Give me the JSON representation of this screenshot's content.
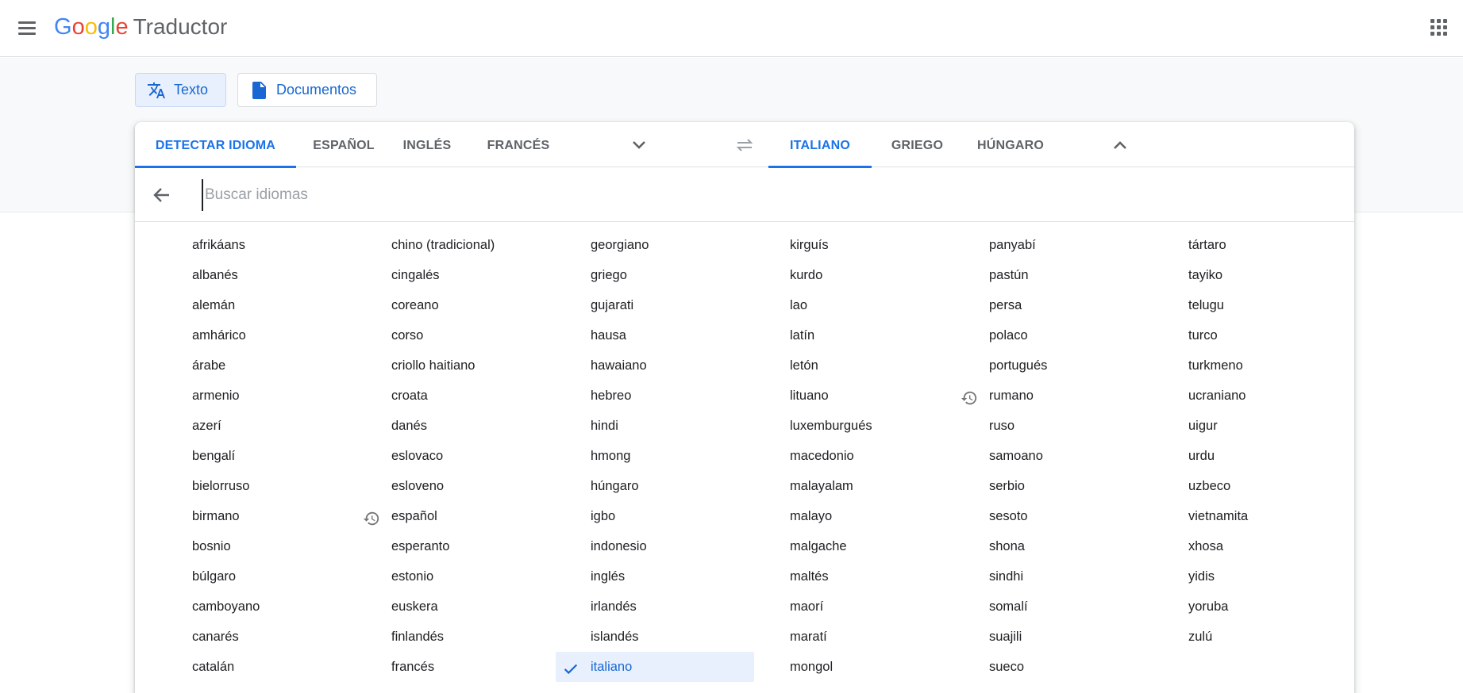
{
  "app": {
    "title": "Traductor",
    "logo_letters": [
      {
        "ch": "G",
        "color": "#4285f4"
      },
      {
        "ch": "o",
        "color": "#ea4335"
      },
      {
        "ch": "o",
        "color": "#fbbc05"
      },
      {
        "ch": "g",
        "color": "#4285f4"
      },
      {
        "ch": "l",
        "color": "#34a853"
      },
      {
        "ch": "e",
        "color": "#ea4335"
      }
    ]
  },
  "modes": {
    "text_label": "Texto",
    "docs_label": "Documentos"
  },
  "source_tabs": {
    "detect": "DETECTAR IDIOMA",
    "t1": "ESPAÑOL",
    "t2": "INGLÉS",
    "t3": "FRANCÉS"
  },
  "target_tabs": {
    "t1": "ITALIANO",
    "t2": "GRIEGO",
    "t3": "HÚNGARO"
  },
  "search": {
    "placeholder": "Buscar idiomas"
  },
  "languages": [
    [
      "afrikáans",
      "albanés",
      "alemán",
      "amhárico",
      "árabe",
      "armenio",
      "azerí",
      "bengalí",
      "bielorruso",
      "birmano",
      "bosnio",
      "búlgaro",
      "camboyano",
      "canarés",
      "catalán"
    ],
    [
      "chino (tradicional)",
      "cingalés",
      "coreano",
      "corso",
      "criollo haitiano",
      "croata",
      "danés",
      "eslovaco",
      "esloveno",
      "español",
      "esperanto",
      "estonio",
      "euskera",
      "finlandés",
      "francés"
    ],
    [
      "georgiano",
      "griego",
      "gujarati",
      "hausa",
      "hawaiano",
      "hebreo",
      "hindi",
      "hmong",
      "húngaro",
      "igbo",
      "indonesio",
      "inglés",
      "irlandés",
      "islandés",
      "italiano"
    ],
    [
      "kirguís",
      "kurdo",
      "lao",
      "latín",
      "letón",
      "lituano",
      "luxemburgués",
      "macedonio",
      "malayalam",
      "malayo",
      "malgache",
      "maltés",
      "maorí",
      "maratí",
      "mongol"
    ],
    [
      "panyabí",
      "pastún",
      "persa",
      "polaco",
      "portugués",
      "rumano",
      "ruso",
      "samoano",
      "serbio",
      "sesoto",
      "shona",
      "sindhi",
      "somalí",
      "suajili",
      "sueco"
    ],
    [
      "tártaro",
      "tayiko",
      "telugu",
      "turco",
      "turkmeno",
      "ucraniano",
      "uigur",
      "urdu",
      "uzbeco",
      "vietnamita",
      "xhosa",
      "yidis",
      "yoruba",
      "zulú"
    ]
  ],
  "recent_languages": [
    "español",
    "rumano"
  ],
  "selected_language": "italiano",
  "colors": {
    "accent": "#1a73e8",
    "selected_bg": "#e8f0fe"
  }
}
